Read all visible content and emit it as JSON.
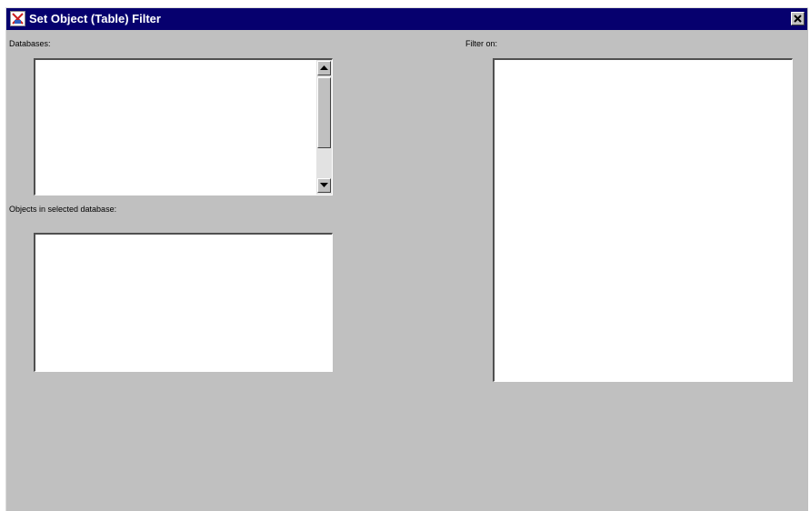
{
  "window": {
    "title": "Set Object (Table) Filter",
    "icon": "app-icon",
    "close_icon": "close-icon"
  },
  "databases": {
    "label": "Databases:",
    "items": []
  },
  "objects": {
    "label": "Objects in selected database:",
    "items": []
  },
  "filter": {
    "label": "Filter on:",
    "items": []
  },
  "colors": {
    "titlebar": "#06006e",
    "dialog_background": "#c0c0c0",
    "list_background": "#ffffff"
  }
}
